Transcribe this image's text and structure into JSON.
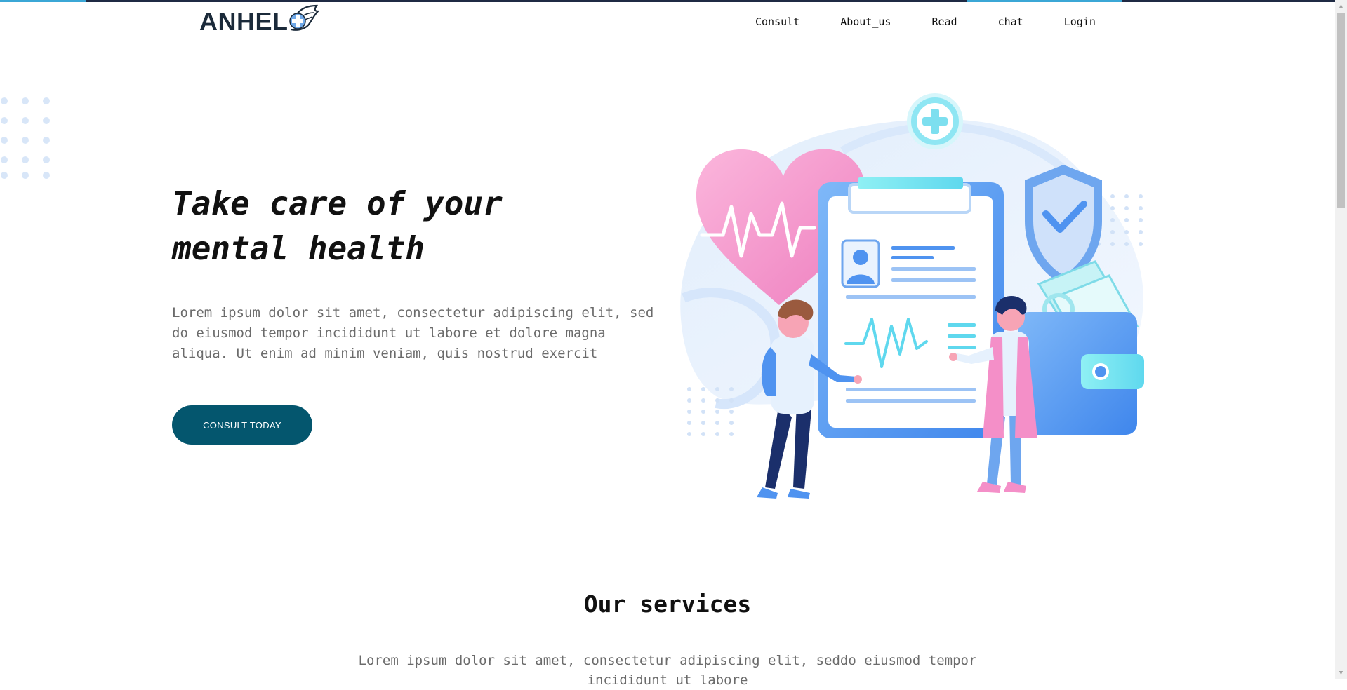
{
  "brand": {
    "name": "ANHEL"
  },
  "nav": {
    "items": [
      {
        "label": "Consult"
      },
      {
        "label": "About_us"
      },
      {
        "label": "Read"
      },
      {
        "label": "chat"
      },
      {
        "label": "Login"
      }
    ]
  },
  "hero": {
    "title_lines": [
      "Take care of your",
      "mental health"
    ],
    "description_lines": [
      "Lorem ipsum dolor sit amet, consectetur adipiscing elit, sed",
      "do eiusmod tempor incididunt ut labore et dolore magna",
      "aliqua. Ut enim ad minim veniam, quis nostrud exercit"
    ],
    "cta_label": "CONSULT TODAY",
    "illustration_icon": "medical-checkup-illustration"
  },
  "services": {
    "title": "Our services",
    "description_lines": [
      "Lorem ipsum dolor sit amet, consectetur adipiscing elit, seddo eiusmod tempor",
      "incididunt ut labore"
    ]
  },
  "colors": {
    "accent": "#04566e",
    "heading": "#111111",
    "body_text": "#6b6b6b",
    "illustration_blue": "#4f93f0",
    "illustration_pink": "#f48fc8"
  }
}
